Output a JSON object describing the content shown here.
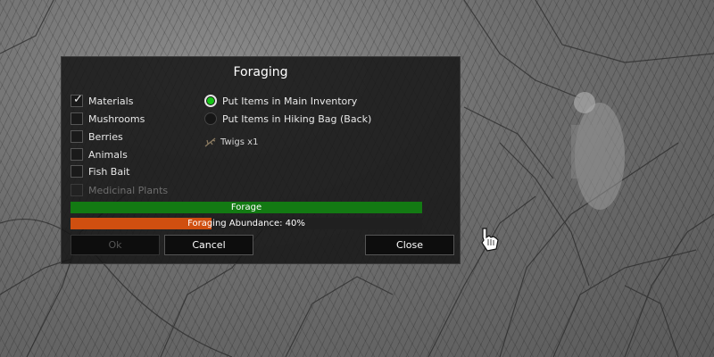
{
  "window": {
    "title": "Foraging"
  },
  "categories": [
    {
      "label": "Materials",
      "checked": true,
      "enabled": true
    },
    {
      "label": "Mushrooms",
      "checked": false,
      "enabled": true
    },
    {
      "label": "Berries",
      "checked": false,
      "enabled": true
    },
    {
      "label": "Animals",
      "checked": false,
      "enabled": true
    },
    {
      "label": "Fish Bait",
      "checked": false,
      "enabled": true
    },
    {
      "label": "Medicinal Plants",
      "checked": false,
      "enabled": false
    }
  ],
  "destination": [
    {
      "label": "Put Items in Main Inventory",
      "selected": true
    },
    {
      "label": "Put Items in Hiking Bag (Back)",
      "selected": false
    }
  ],
  "found_items": [
    {
      "label": "Twigs x1",
      "icon": "twigs-icon"
    }
  ],
  "bars": {
    "forage": {
      "label": "Forage",
      "progress": 1.0,
      "color": "#137a13"
    },
    "abundance": {
      "label": "Foraging Abundance: 40%",
      "progress": 0.4,
      "color": "#d04f10"
    }
  },
  "buttons": {
    "ok": "Ok",
    "cancel": "Cancel",
    "close": "Close"
  },
  "colors": {
    "panel_bg": "#161616",
    "radio_selected": "#17c417",
    "forage_bar": "#137a13",
    "abundance_bar": "#d04f10"
  }
}
